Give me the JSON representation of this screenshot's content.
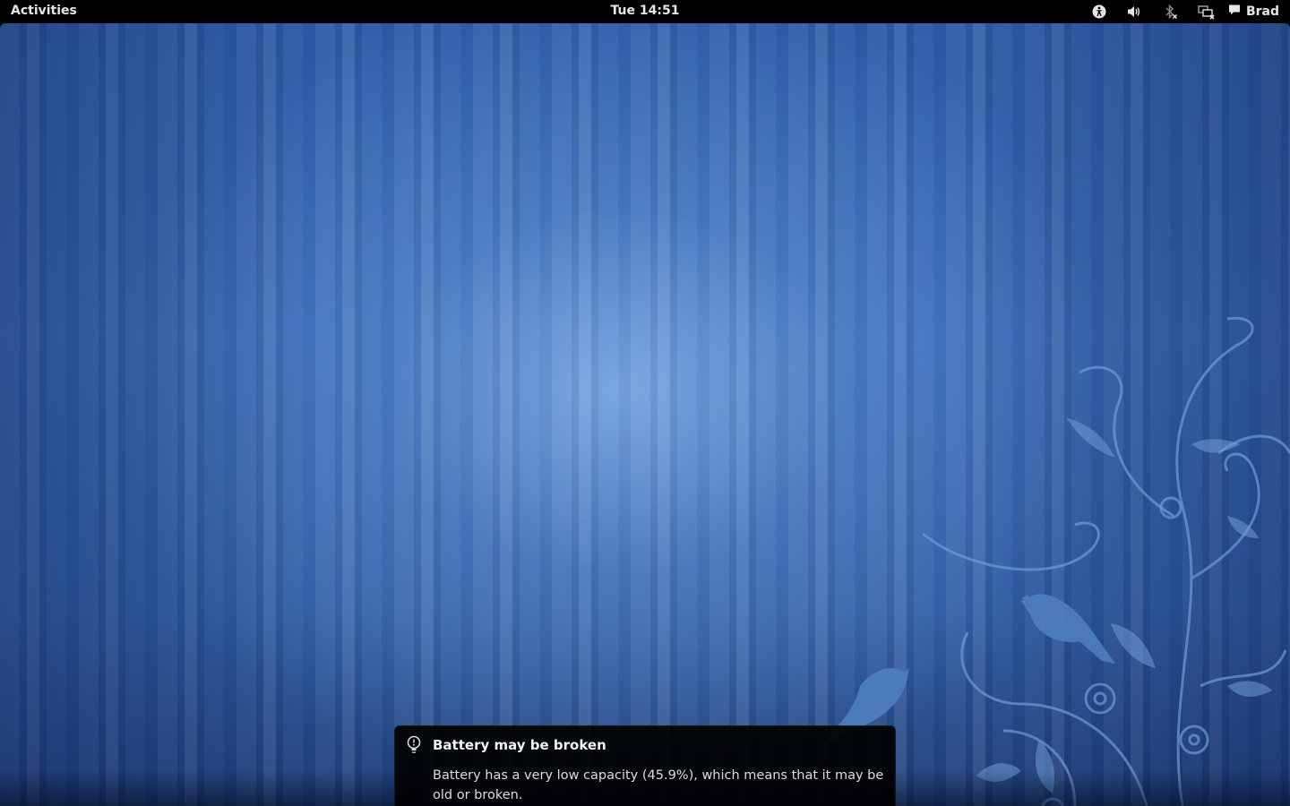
{
  "topbar": {
    "activities_label": "Activities",
    "clock": "Tue 14:51",
    "tray_icons": [
      "accessibility-icon",
      "volume-icon",
      "bluetooth-disabled-icon",
      "network-disconnected-icon"
    ],
    "user": {
      "icon": "chat-status-icon",
      "name": "Brad"
    }
  },
  "desktop": {
    "wallpaper_colors": {
      "base": "#2f5ba3",
      "highlight": "#8cb9f0",
      "floral": "#6f9bd6"
    }
  },
  "notification": {
    "icon": "battery-warning-icon",
    "title": "Battery may be broken",
    "body": "Battery has a very low capacity (45.9%), which means that it may be old or broken."
  }
}
